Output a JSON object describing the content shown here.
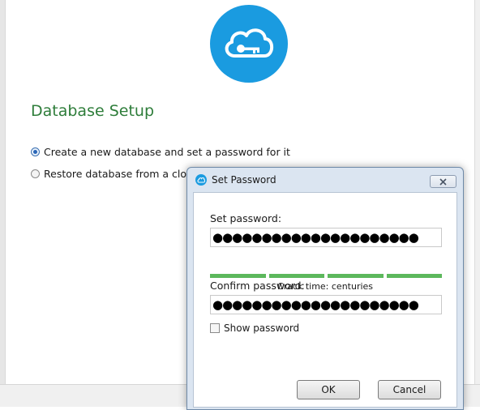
{
  "app": {
    "title": "Database Setup",
    "logo_icon": "cloud-key-icon",
    "brand_color": "#1a9be0",
    "title_color": "#2e7d3a"
  },
  "options": [
    {
      "label": "Create a new database and set a password for it",
      "selected": true
    },
    {
      "label": "Restore database from a cloud",
      "selected": false
    }
  ],
  "dialog": {
    "title": "Set Password",
    "icon": "app-cloud-icon",
    "close_icon": "close-icon",
    "set_password_label": "Set password:",
    "set_password_value": "●●●●●●●●●●●●●●●●●●●●●",
    "strength_segments": 4,
    "strength_color": "#5cb85c",
    "crack_time": "Crack time: centuries",
    "confirm_password_label": "Confirm password:",
    "confirm_password_value": "●●●●●●●●●●●●●●●●●●●●●",
    "show_password_label": "Show password",
    "show_password_checked": false,
    "ok_label": "OK",
    "cancel_label": "Cancel"
  }
}
